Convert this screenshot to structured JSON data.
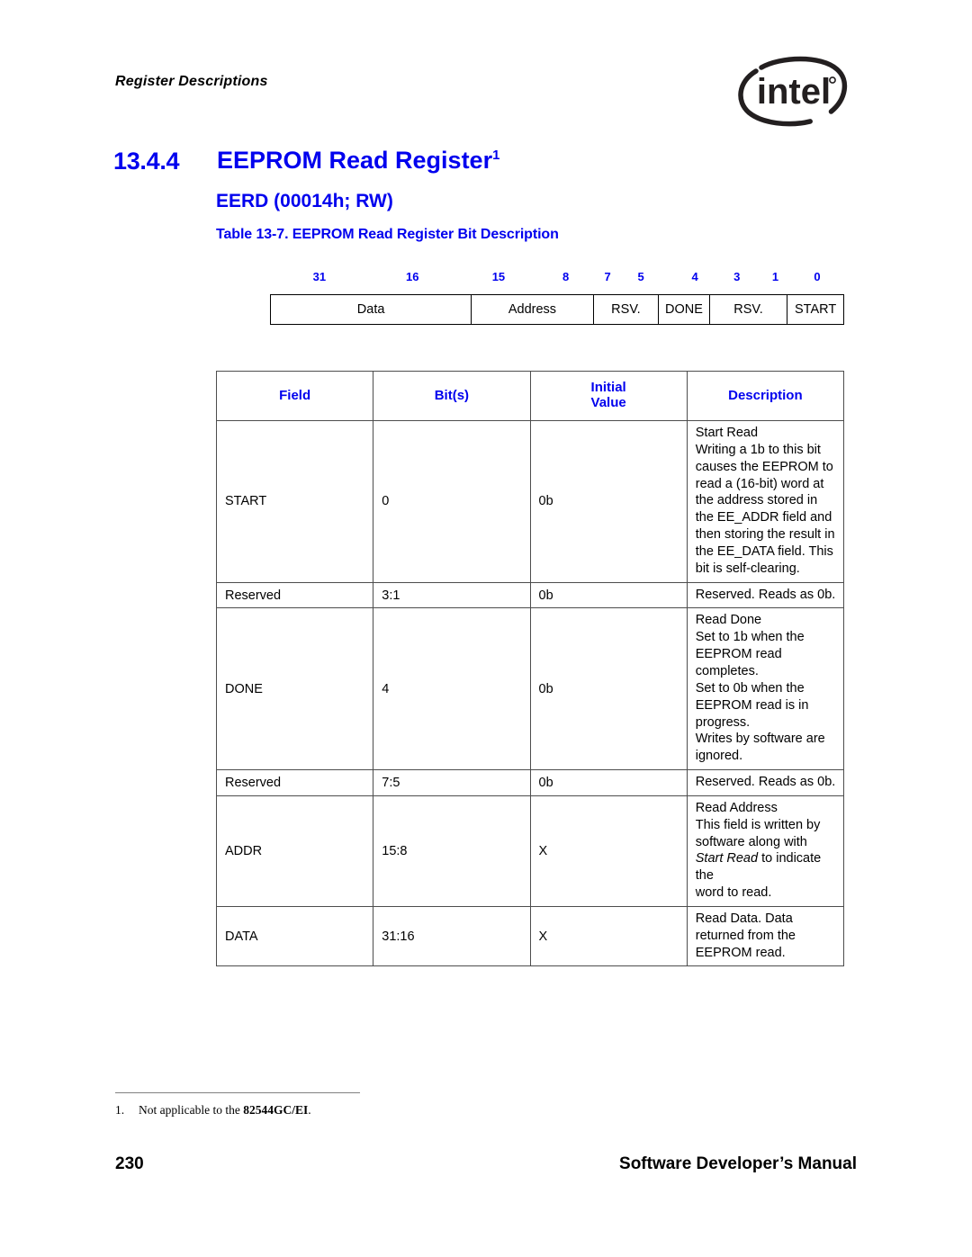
{
  "header": {
    "running_head": "Register Descriptions",
    "logo": {
      "wordmark": "intel",
      "trademark": "®"
    }
  },
  "heading": {
    "section_number": "13.4.4",
    "title": "EEPROM Read Register",
    "title_footnote_marker": "1",
    "register_subtitle": "EERD (00014h; RW)",
    "table_caption": "Table 13-7. EEPROM Read Register Bit Description"
  },
  "bit_diagram": {
    "bit_labels": [
      {
        "text": "31",
        "pos_pct": 8.6
      },
      {
        "text": "16",
        "pos_pct": 24.8
      },
      {
        "text": "15",
        "pos_pct": 39.8
      },
      {
        "text": "8",
        "pos_pct": 51.5
      },
      {
        "text": "7",
        "pos_pct": 58.8
      },
      {
        "text": "5",
        "pos_pct": 64.6
      },
      {
        "text": "4",
        "pos_pct": 74.0
      },
      {
        "text": "3",
        "pos_pct": 81.3
      },
      {
        "text": "1",
        "pos_pct": 88.0
      },
      {
        "text": "0",
        "pos_pct": 95.3
      }
    ],
    "fields": [
      {
        "label": "Data",
        "width_pct": 35.1
      },
      {
        "label": "Address",
        "width_pct": 21.3
      },
      {
        "label": "RSV.",
        "width_pct": 11.4
      },
      {
        "label": "DONE",
        "width_pct": 8.9
      },
      {
        "label": "RSV.",
        "width_pct": 13.6
      },
      {
        "label": "START",
        "width_pct": 9.7
      }
    ]
  },
  "field_table": {
    "columns": [
      "Field",
      "Bit(s)",
      "Initial\nValue",
      "Description"
    ],
    "columns_split": {
      "field": "Field",
      "bits": "Bit(s)",
      "initial": "Initial",
      "value": "Value",
      "description": "Description"
    },
    "rows": [
      {
        "field": "START",
        "bits": "0",
        "initial": "0b",
        "description_lines": [
          "Start Read",
          "Writing a 1b to this bit causes the EEPROM to read a (16-bit) word at",
          "the address stored in the EE_ADDR field and then storing the result in",
          "the EE_DATA field. This bit is self-clearing."
        ]
      },
      {
        "field": "Reserved",
        "bits": "3:1",
        "initial": "0b",
        "description_lines": [
          "Reserved. Reads as 0b."
        ]
      },
      {
        "field": "DONE",
        "bits": "4",
        "initial": "0b",
        "description_lines": [
          "Read Done",
          "Set to 1b when the EEPROM read completes.",
          "Set to 0b when the EEPROM read is in progress.",
          "Writes by software are ignored."
        ]
      },
      {
        "field": "Reserved",
        "bits": "7:5",
        "initial": "0b",
        "description_lines": [
          "Reserved. Reads as 0b."
        ]
      },
      {
        "field": "ADDR",
        "bits": "15:8",
        "initial": "X",
        "description_lines": [
          "Read Address",
          "This field is written by software along with <i>Start Read</i> to indicate the",
          "word to read."
        ]
      },
      {
        "field": "DATA",
        "bits": "31:16",
        "initial": "X",
        "description_lines": [
          "Read Data. Data returned from the EEPROM read."
        ]
      }
    ]
  },
  "footnote": {
    "marker": "1.",
    "text_before": "Not applicable to the ",
    "bold_part": "82544GC/EI",
    "text_after": "."
  },
  "footer": {
    "page_number": "230",
    "manual_title": "Software Developer’s Manual"
  },
  "colors": {
    "heading_blue": "#0000ee",
    "table_border": "#4d4d4d",
    "diagram_border": "#000000",
    "text": "#000000",
    "rule_gray": "#808080"
  }
}
